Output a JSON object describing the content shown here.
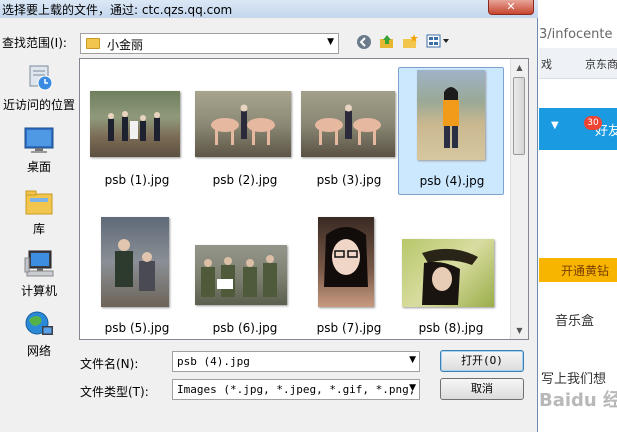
{
  "dialog": {
    "title": "选择要上载的文件，通过: ctc.qzs.qq.com",
    "close_label": "✕",
    "look_in_label": "查找范围(I):",
    "look_in_value": "小金丽",
    "places": [
      {
        "label": "近访问的位置",
        "icon": "recent-places-icon"
      },
      {
        "label": "桌面",
        "icon": "desktop-icon"
      },
      {
        "label": "库",
        "icon": "library-icon"
      },
      {
        "label": "计算机",
        "icon": "computer-icon"
      },
      {
        "label": "网络",
        "icon": "network-icon"
      }
    ],
    "files": [
      {
        "name": "psb (1).jpg",
        "selected": false
      },
      {
        "name": "psb (2).jpg",
        "selected": false
      },
      {
        "name": "psb (3).jpg",
        "selected": false
      },
      {
        "name": "psb (4).jpg",
        "selected": true
      },
      {
        "name": "psb (5).jpg",
        "selected": false
      },
      {
        "name": "psb (6).jpg",
        "selected": false
      },
      {
        "name": "psb (7).jpg",
        "selected": false
      },
      {
        "name": "psb (8).jpg",
        "selected": false
      }
    ],
    "filename_label": "文件名(N):",
    "filename_value": "psb (4).jpg",
    "filetype_label": "文件类型(T):",
    "filetype_value": "Images (*.jpg, *.jpeg, *.gif, *.png,",
    "open_label": "打开(O)",
    "cancel_label": "取消"
  },
  "background": {
    "url_fragment": "3/infocente",
    "bookmark_1": "戏",
    "bookmark_2": "京东商",
    "badge_count": "30",
    "friends_text": "好友",
    "yellow_text": "开通黄钻",
    "music_text": "音乐盒",
    "write_text": "写上我们想",
    "watermark": "Baidu 经验"
  }
}
